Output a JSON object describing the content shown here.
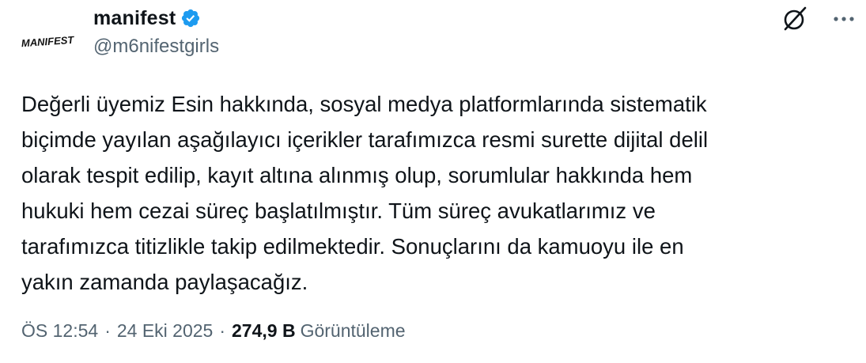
{
  "author": {
    "display_name": "manifest",
    "handle": "@m6nifestgirls",
    "avatar_text": "MANIFEST",
    "verified": true
  },
  "tweet": {
    "text": "Değerli üyemiz Esin hakkında, sosyal medya platformlarında sistematik\nbiçimde yayılan aşağılayıcı içerikler tarafımızca resmi surette dijital delil\nolarak tespit edilip, kayıt altına alınmış olup, sorumlular hakkında hem\nhukuki hem cezai süreç başlatılmıştır. Tüm süreç avukatlarımız ve\ntarafımızca titizlikle takip edilmektedir. Sonuçlarını da kamuoyu ile en\nyakın zamanda paylaşacağız."
  },
  "meta": {
    "time": "ÖS 12:54",
    "separator": "·",
    "date": "24 Eki 2025",
    "views_count": "274,9 B",
    "views_label": "Görüntüleme"
  },
  "icons": {
    "verified": "verified-badge-icon",
    "grok": "grok-icon",
    "more": "more-options-icon"
  },
  "colors": {
    "text_primary": "#0f1419",
    "text_secondary": "#536471",
    "verified_blue": "#1d9bf0"
  }
}
